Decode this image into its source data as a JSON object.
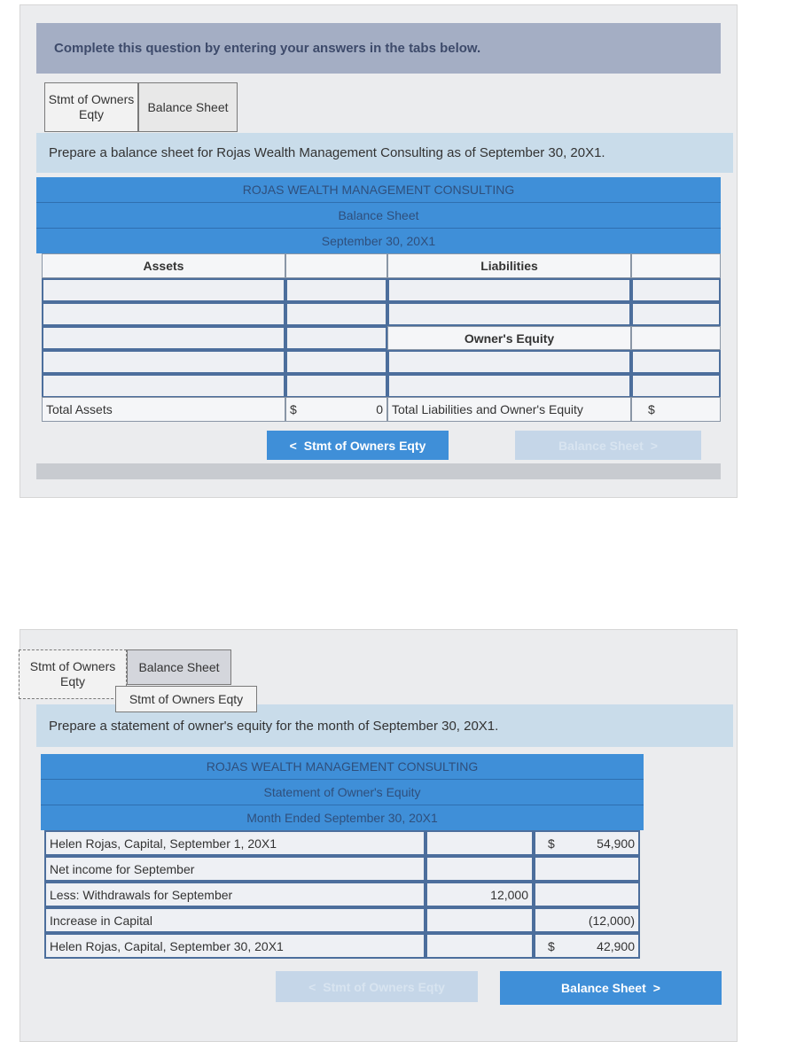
{
  "balance_sheet_panel": {
    "question_prompt": "Complete this question by entering your answers in the tabs below.",
    "tabs": [
      {
        "label": "Stmt of Owners Eqty"
      },
      {
        "label": "Balance Sheet"
      }
    ],
    "instruction": "Prepare a balance sheet for Rojas Wealth Management Consulting as of September 30, 20X1.",
    "company": "ROJAS WEALTH MANAGEMENT CONSULTING",
    "statement": "Balance Sheet",
    "date": "September 30, 20X1",
    "assets_header": "Assets",
    "liabilities_header": "Liabilities",
    "owners_equity_header": "Owner's Equity",
    "total_assets_label": "Total Assets",
    "total_assets_currency": "$",
    "total_assets_value": "0",
    "total_le_label": "Total Liabilities and Owner's Equity",
    "total_le_currency": "$",
    "prev_button": "Stmt of Owners Eqty",
    "next_button": "Balance Sheet"
  },
  "equity_panel": {
    "tabs": [
      {
        "label": "Stmt of Owners Eqty"
      },
      {
        "label": "Balance Sheet"
      }
    ],
    "tooltip": "Stmt of Owners Eqty",
    "instruction": "Prepare a statement of owner's equity for the month of September 30, 20X1.",
    "company": "ROJAS WEALTH MANAGEMENT CONSULTING",
    "statement": "Statement of Owner's Equity",
    "period": "Month Ended September 30, 20X1",
    "rows": [
      {
        "label": "Helen Rojas, Capital, September 1, 20X1",
        "col1": "",
        "currency": "$",
        "col2": "54,900"
      },
      {
        "label": "Net income for September",
        "col1": "",
        "currency": "",
        "col2": ""
      },
      {
        "label": "Less: Withdrawals for September",
        "col1": "12,000",
        "currency": "",
        "col2": ""
      },
      {
        "label": "Increase in Capital",
        "col1": "",
        "currency": "",
        "col2": "(12,000)"
      },
      {
        "label": "Helen Rojas, Capital, September 30, 20X1",
        "col1": "",
        "currency": "$",
        "col2": "42,900"
      }
    ],
    "prev_button": "Stmt of Owners Eqty",
    "next_button": "Balance Sheet"
  }
}
